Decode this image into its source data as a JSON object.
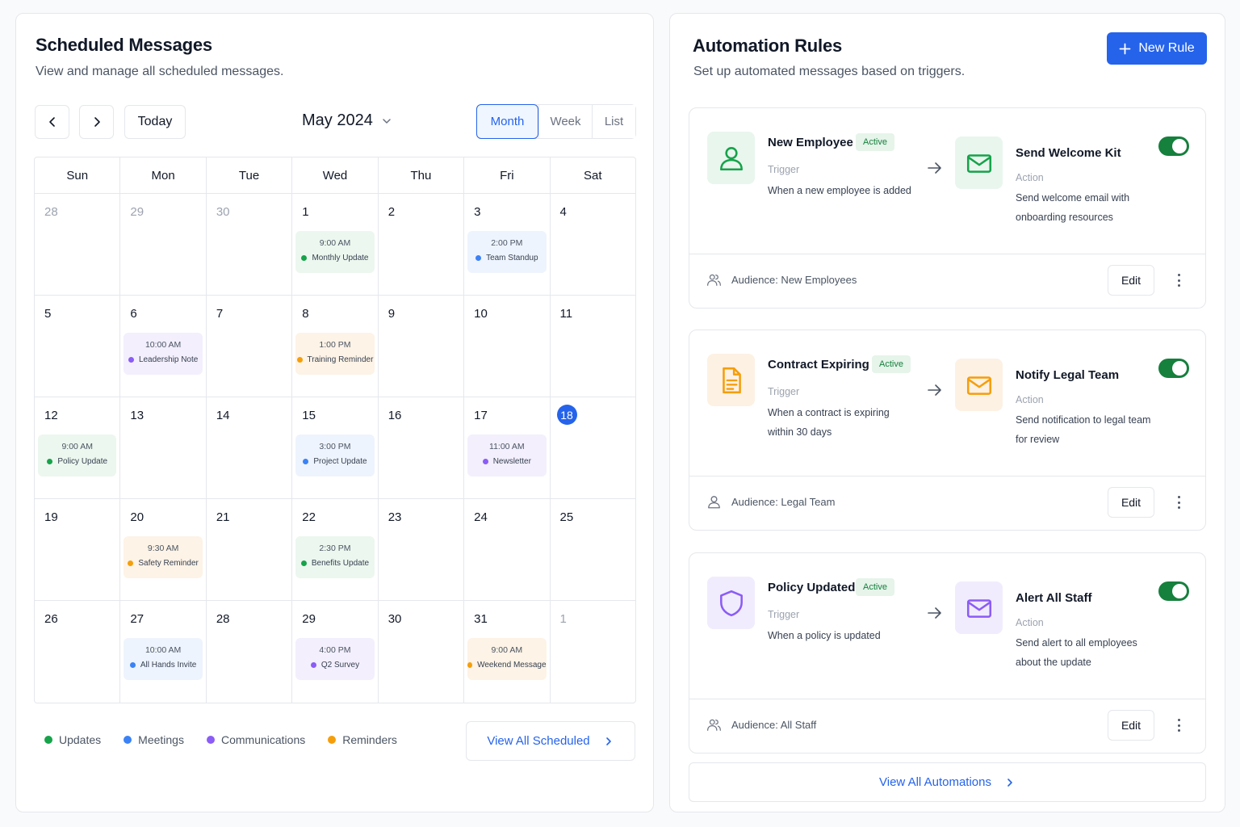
{
  "schedule": {
    "title": "Scheduled Messages",
    "subtitle": "View and manage all scheduled messages.",
    "today_label": "Today",
    "month_label": "May 2024",
    "views": [
      "Month",
      "Week",
      "List"
    ],
    "active_view": "Month",
    "weekdays": [
      "Sun",
      "Mon",
      "Tue",
      "Wed",
      "Thu",
      "Fri",
      "Sat"
    ],
    "weeks": [
      [
        {
          "num": "28",
          "muted": true
        },
        {
          "num": "29",
          "muted": true
        },
        {
          "num": "30",
          "muted": true
        },
        {
          "num": "1",
          "event": {
            "time": "9:00 AM",
            "title": "Monthly Update",
            "category": "updates"
          }
        },
        {
          "num": "2"
        },
        {
          "num": "3",
          "event": {
            "time": "2:00 PM",
            "title": "Team Standup",
            "category": "meetings"
          }
        },
        {
          "num": "4"
        }
      ],
      [
        {
          "num": "5"
        },
        {
          "num": "6",
          "event": {
            "time": "10:00 AM",
            "title": "Leadership Note",
            "category": "communications"
          }
        },
        {
          "num": "7"
        },
        {
          "num": "8",
          "event": {
            "time": "1:00 PM",
            "title": "Training Reminder",
            "category": "reminders"
          }
        },
        {
          "num": "9"
        },
        {
          "num": "10"
        },
        {
          "num": "11"
        }
      ],
      [
        {
          "num": "12",
          "event": {
            "time": "9:00 AM",
            "title": "Policy Update",
            "category": "updates"
          }
        },
        {
          "num": "13"
        },
        {
          "num": "14"
        },
        {
          "num": "15",
          "event": {
            "time": "3:00 PM",
            "title": "Project Update",
            "category": "meetings"
          }
        },
        {
          "num": "16"
        },
        {
          "num": "17",
          "event": {
            "time": "11:00 AM",
            "title": "Newsletter",
            "category": "communications"
          }
        },
        {
          "num": "18",
          "today": true
        }
      ],
      [
        {
          "num": "19"
        },
        {
          "num": "20",
          "event": {
            "time": "9:30 AM",
            "title": "Safety Reminder",
            "category": "reminders"
          }
        },
        {
          "num": "21"
        },
        {
          "num": "22",
          "event": {
            "time": "2:30 PM",
            "title": "Benefits Update",
            "category": "updates"
          }
        },
        {
          "num": "23"
        },
        {
          "num": "24"
        },
        {
          "num": "25"
        }
      ],
      [
        {
          "num": "26"
        },
        {
          "num": "27",
          "event": {
            "time": "10:00 AM",
            "title": "All Hands Invite",
            "category": "meetings"
          }
        },
        {
          "num": "28"
        },
        {
          "num": "29",
          "event": {
            "time": "4:00 PM",
            "title": "Q2 Survey",
            "category": "communications"
          }
        },
        {
          "num": "30"
        },
        {
          "num": "31",
          "event": {
            "time": "9:00 AM",
            "title": "Weekend Message",
            "category": "reminders"
          }
        },
        {
          "num": "1",
          "muted": true
        }
      ]
    ],
    "categories": {
      "updates": {
        "label": "Updates",
        "dot": "#16a34a",
        "bg": "#ecf7ef"
      },
      "meetings": {
        "label": "Meetings",
        "dot": "#3b82f6",
        "bg": "#eef4fd"
      },
      "communications": {
        "label": "Communications",
        "dot": "#8b5cf6",
        "bg": "#f3effd"
      },
      "reminders": {
        "label": "Reminders",
        "dot": "#f59e0b",
        "bg": "#fdf3e6"
      }
    },
    "legend_order": [
      "updates",
      "meetings",
      "communications",
      "reminders"
    ],
    "view_all_label": "View All Scheduled"
  },
  "automation": {
    "title": "Automation Rules",
    "subtitle": "Set up automated messages based on triggers.",
    "new_rule_label": "New Rule",
    "rules": [
      {
        "name": "New Employee",
        "status": "Active",
        "trigger_label": "Trigger",
        "trigger_desc": "When a new employee is added",
        "trigger_icon": "user-icon",
        "action_name": "Send Welcome Kit",
        "action_label": "Action",
        "action_desc": "Send welcome email with onboarding resources",
        "audience": "Audience: New Employees",
        "audience_icon": "users-icon",
        "edit_label": "Edit",
        "enabled": true,
        "color": "#16a34a",
        "tint": "#e9f6ee"
      },
      {
        "name": "Contract Expiring",
        "status": "Active",
        "trigger_label": "Trigger",
        "trigger_desc": "When a contract is expiring within 30 days",
        "trigger_icon": "document-icon",
        "action_name": "Notify Legal Team",
        "action_label": "Action",
        "action_desc": "Send notification to legal team for review",
        "audience": "Audience: Legal Team",
        "audience_icon": "user-icon",
        "edit_label": "Edit",
        "enabled": true,
        "color": "#f59e0b",
        "tint": "#fdf1e3"
      },
      {
        "name": "Policy Updated",
        "status": "Active",
        "trigger_label": "Trigger",
        "trigger_desc": "When a policy is updated",
        "trigger_icon": "shield-icon",
        "action_name": "Alert All Staff",
        "action_label": "Action",
        "action_desc": "Send alert to all employees about the update",
        "audience": "Audience: All Staff",
        "audience_icon": "users-icon",
        "edit_label": "Edit",
        "enabled": true,
        "color": "#8b5cf6",
        "tint": "#f1ecfd"
      }
    ],
    "view_all_label": "View All Automations"
  }
}
